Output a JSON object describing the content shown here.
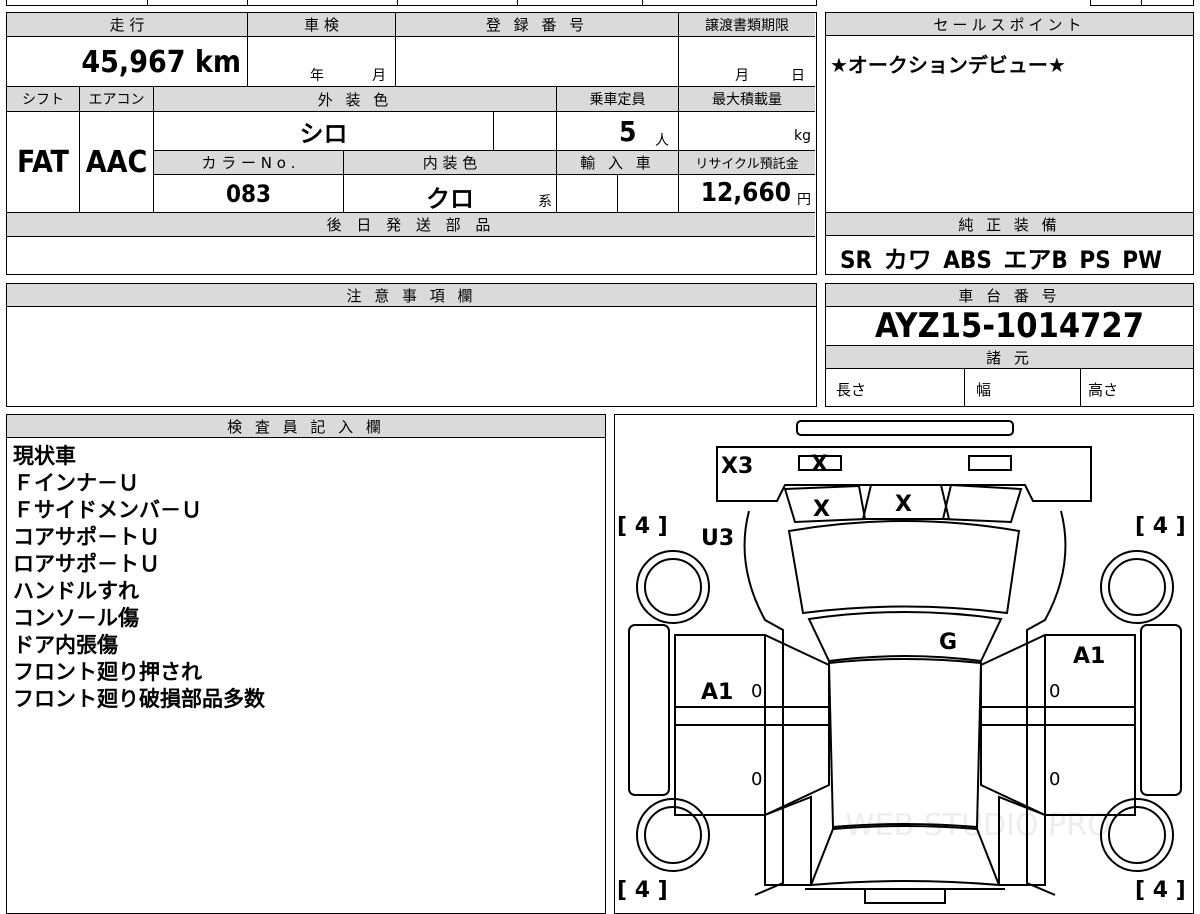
{
  "vehicle_info": {
    "mileage_label": "走 行",
    "mileage_value": "45,967",
    "mileage_unit": "km",
    "shaken_label": "車 検",
    "shaken_year_unit": "年",
    "shaken_month_unit": "月",
    "reg_label": "登 録 番 号",
    "transfer_label": "譲渡書類期限",
    "transfer_month_unit": "月",
    "transfer_day_unit": "日",
    "shift_label": "シフト",
    "shift_value": "FAT",
    "ac_label": "エアコン",
    "ac_value": "AAC",
    "exterior_label": "外 装 色",
    "exterior_value": "シロ",
    "capacity_label": "乗車定員",
    "capacity_value": "5",
    "capacity_unit": "人",
    "max_load_label": "最大積載量",
    "max_load_unit": "kg",
    "color_no_label": "カ ラ ー N o .",
    "color_no_value": "083",
    "interior_label": "内 装 色",
    "interior_value": "クロ",
    "interior_unit": "系",
    "import_label": "輸 入 車",
    "recycle_label": "リサイクル預託金",
    "recycle_value": "12,660",
    "recycle_unit": "円",
    "later_parts_label": "後 日 発 送 部 品"
  },
  "sales_point": {
    "label": "セールスポイント",
    "text": "★オークションデビュー★"
  },
  "genuine_equipment": {
    "label": "純 正 装 備",
    "text": "SR カワ ABS エアB PS PW"
  },
  "notes": {
    "label": "注 意 事 項 欄"
  },
  "chassis": {
    "label": "車 台 番 号",
    "value": "AYZ15-1014727",
    "spec_label": "諸 元",
    "length_label": "長さ",
    "width_label": "幅",
    "height_label": "高さ"
  },
  "inspector": {
    "label": "検 査 員 記 入 欄",
    "lines": [
      "現状車",
      "Ｆインナ－Ｕ",
      "Ｆサイドメンバ－Ｕ",
      "コアサポ－トＵ",
      "ロアサポ－トＵ",
      "ハンドルすれ",
      "コンソ－ル傷",
      "ドア内張傷",
      "フロント廻り押され",
      "フロント廻り破損部品多数"
    ]
  },
  "diagram": {
    "marks": {
      "x3": "X3",
      "x_top": "X",
      "x_left": "X",
      "x_mid": "X",
      "u3": "U3",
      "g": "G",
      "a1_left": "A1",
      "a1_right": "A1",
      "zero": "0"
    },
    "tire_tl": "[ 4 ]",
    "tire_tr": "[ 4 ]",
    "tire_bl": "[ 4 ]",
    "tire_br": "[ 4 ]",
    "watermark": "WEB STUDIO PRO"
  }
}
